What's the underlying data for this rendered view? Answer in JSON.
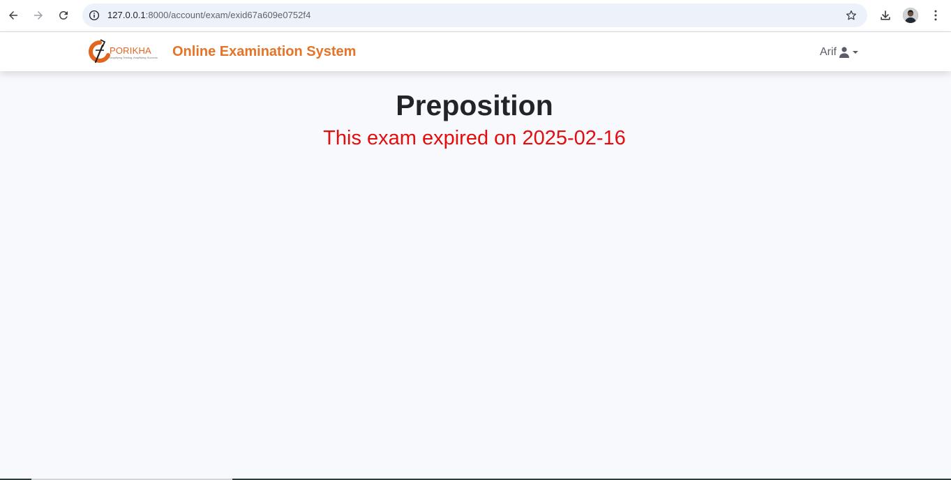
{
  "browser": {
    "url_host": "127.0.0.1",
    "url_path": ":8000/account/exam/exid67a609e0752f4"
  },
  "navbar": {
    "logo_text": "PORIKHA",
    "logo_tagline": "Simplifying Testing, Amplifying Success",
    "brand_title": "Online Examination System",
    "user_name": "Arif"
  },
  "exam": {
    "title": "Preposition",
    "status_message": "This exam expired on 2025-02-16"
  },
  "colors": {
    "brand_orange": "#e67327",
    "expired_red": "#e40d0d",
    "title_dark": "#212529",
    "page_bg": "#f8f9fc"
  }
}
